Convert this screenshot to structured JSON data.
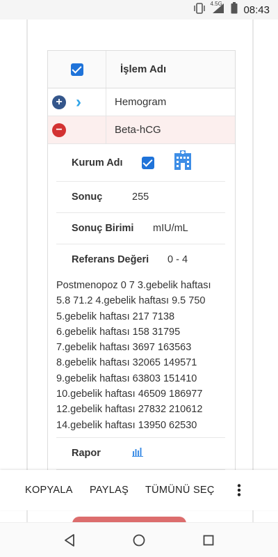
{
  "status_bar": {
    "time": "08:43",
    "network": "4.5G"
  },
  "table": {
    "header": {
      "title": "İşlem Adı",
      "select_all_checked": true
    },
    "rows": [
      {
        "label": "Hemogram",
        "expanded": false
      },
      {
        "label": "Beta-hCG",
        "expanded": true
      }
    ]
  },
  "detail": {
    "institution": {
      "label": "Kurum Adı",
      "checked": true
    },
    "result": {
      "label": "Sonuç",
      "value": "255"
    },
    "unit": {
      "label": "Sonuç Birimi",
      "value": "mIU/mL"
    },
    "reference": {
      "label": "Referans Değeri",
      "value": "0 - 4",
      "lines": [
        "Postmenopoz 0 7 3.gebelik haftası",
        "5.8 71.2 4.gebelik haftası 9.5 750",
        "5.gebelik haftası 217 7138",
        "6.gebelik haftası 158 31795",
        "7.gebelik haftası 3697 163563",
        "8.gebelik haftası 32065 149571",
        "9.gebelik haftası 63803 151410",
        "10.gebelik haftası 46509 186977",
        "12.gebelik haftası 27832 210612",
        "14.gebelik haftası 13950 62530"
      ]
    },
    "report": {
      "label": "Rapor"
    }
  },
  "context_menu": {
    "copy": "KOPYALA",
    "share": "PAYLAŞ",
    "select_all": "TÜMÜNÜ SEÇ"
  },
  "colors": {
    "checkbox": "#1f73d9",
    "expand": "#34568b",
    "collapse": "#d33232",
    "chevron": "#31a5e8",
    "expanded_row_bg": "#fcefee"
  }
}
